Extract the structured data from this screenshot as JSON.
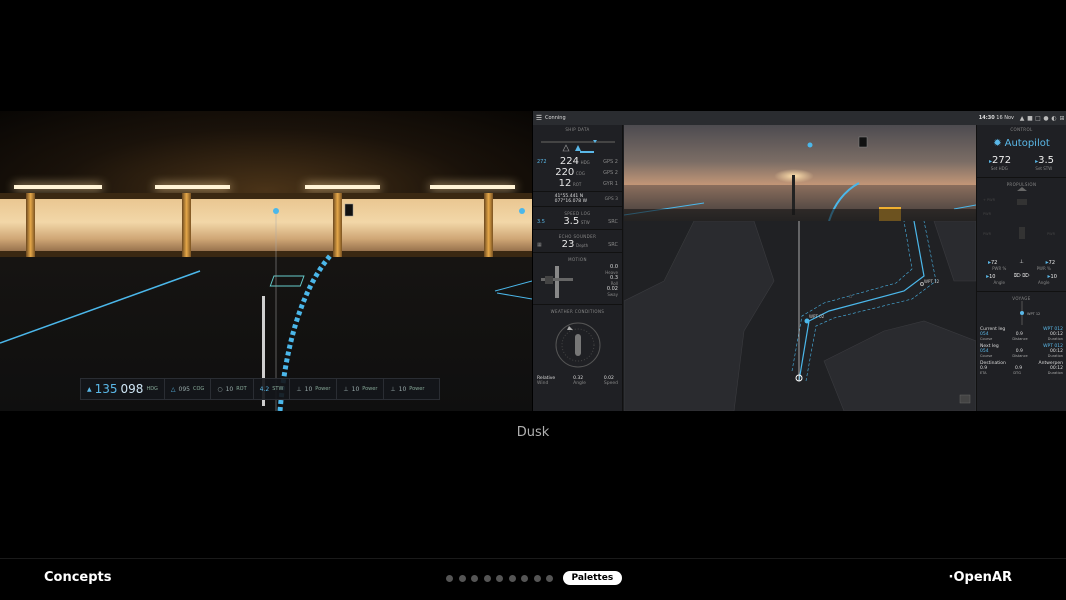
{
  "caption": "Dusk",
  "footer": {
    "brand": "Concepts",
    "logo": "OpenAR",
    "active_tab": "Palettes",
    "page_dot_count": 9
  },
  "hud": {
    "heading_set": "135",
    "heading": "098",
    "heading_unit": "HDG",
    "cog": "095",
    "cog_label": "COG",
    "rot": "10",
    "rot_label": "ROT",
    "stw": "4.2",
    "stw_label": "STW",
    "power1": "10",
    "power1_label": "Power",
    "power2": "10",
    "power2_label": "Power",
    "power3": "10",
    "power3_label": "Power"
  },
  "conning": {
    "title": "Conning",
    "time": "14:30",
    "date": "16 Nov",
    "ship_data_title": "SHIP DATA",
    "hdg_set": "272",
    "hdg": "224",
    "hdg_label": "HDG",
    "hdg_src": "GPS 2",
    "cog": "220",
    "cog_label": "COG",
    "cog_src": "GPS 2",
    "rot": "12",
    "rot_label": "ROT",
    "rot_src": "GYR 1",
    "lat": "41°55.441",
    "lat_h": "N",
    "lon": "077°16.078",
    "lon_h": "W",
    "pos_src": "GPS 3",
    "speed_log_title": "SPEED LOG",
    "speed_set": "3.5",
    "speed": "3.5",
    "speed_label": "STW",
    "speed_src": "SRC",
    "echo_title": "ECHO SOUNDER",
    "depth": "23",
    "depth_label": "Depth",
    "depth_src": "SRC",
    "motion_title": "MOTION",
    "heave": "0.0",
    "heave_label": "Heave",
    "roll": "0.3",
    "roll_label": "Roll",
    "sway": "0.02",
    "sway_label": "Sway",
    "weather_title": "WEATHER CONDITIONS",
    "wind_label": "Relative",
    "wind_sub": "Wind",
    "wind_angle": "0.32",
    "wind_angle_label": "Angle",
    "wind_speed": "0.02",
    "wind_speed_label": "Speed"
  },
  "control": {
    "title": "CONTROL",
    "mode": "Autopilot",
    "set_hdg": "272",
    "set_hdg_label": "Set HDG",
    "set_stw": "3.5",
    "set_stw_label": "Set STW",
    "propulsion_title": "PROPULSION",
    "thr_l": "72",
    "thr_l_label": "PWR %",
    "thr_r": "72",
    "thr_r_label": "PWR %",
    "ang_l": "10",
    "ang_l_label": "Angle",
    "ang_r": "10",
    "ang_r_label": "Angle",
    "voyage_title": "VOYAGE",
    "wpt_name": "WPT 12",
    "cur_leg_label": "Current leg",
    "cur_leg_wpt": "WPT 012",
    "cur_course": "054",
    "cur_course_label": "Course",
    "cur_dist": "0.9",
    "cur_dist_label": "Distance",
    "cur_dur": "00:12",
    "cur_dur_label": "Duration",
    "next_leg_label": "Next leg",
    "next_leg_wpt": "WPT 012",
    "next_course": "054",
    "next_course_label": "Course",
    "next_dist": "0.9",
    "next_dist_label": "Distance",
    "next_dur": "00:12",
    "next_dur_label": "Duration",
    "dest_label": "Destination",
    "dest_name": "Antwerpen",
    "eta": "0.9",
    "eta_label": "ETA",
    "dtg": "0.9",
    "dtg_label": "DTG",
    "ttg": "00:12",
    "ttg_label": "Duration"
  },
  "map": {
    "wpt_label": "WPT 02",
    "wpt_label2": "WPT 12"
  },
  "colors": {
    "accent": "#5ab8e8",
    "panel": "#1f2024",
    "background": "#000000"
  }
}
